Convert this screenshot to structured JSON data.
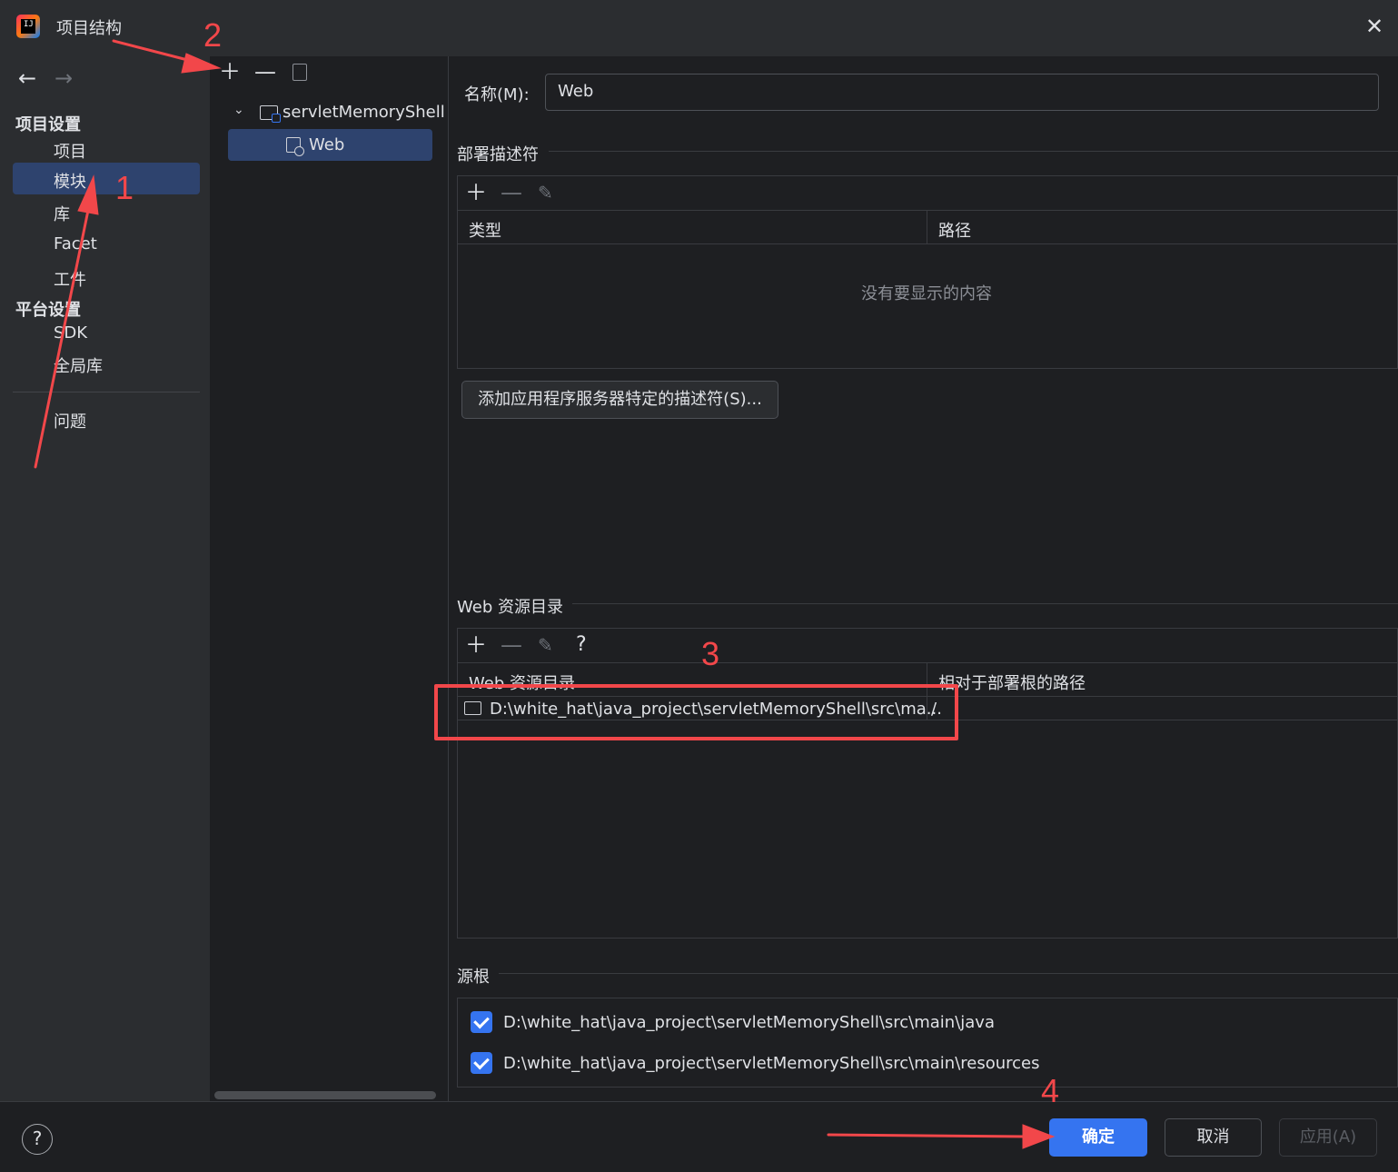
{
  "window": {
    "title": "项目结构",
    "app_logo_text": "IJ"
  },
  "sidebar": {
    "section_project": "项目设置",
    "items_project": [
      {
        "label": "项目"
      },
      {
        "label": "模块",
        "selected": true
      },
      {
        "label": "库"
      },
      {
        "label": "Facet"
      },
      {
        "label": "工件"
      }
    ],
    "section_platform": "平台设置",
    "items_platform": [
      {
        "label": "SDK"
      },
      {
        "label": "全局库"
      }
    ],
    "problems": "问题"
  },
  "module_tree": {
    "root": "servletMemoryShell",
    "child": "Web"
  },
  "facet": {
    "name_label": "名称(M):",
    "name_value": "Web",
    "deploy_section": "部署描述符",
    "deploy_columns": [
      "类型",
      "路径"
    ],
    "deploy_empty": "没有要显示的内容",
    "add_descriptor_button": "添加应用程序服务器特定的描述符(S)...",
    "web_res_section": "Web 资源目录",
    "web_res_columns": [
      "Web 资源目录",
      "相对于部署根的路径"
    ],
    "web_res_rows": [
      {
        "dir": "D:\\white_hat\\java_project\\servletMemoryShell\\src\\ma...",
        "path": "/"
      }
    ],
    "source_roots_section": "源根",
    "source_roots": [
      {
        "path": "D:\\white_hat\\java_project\\servletMemoryShell\\src\\main\\java",
        "checked": true
      },
      {
        "path": "D:\\white_hat\\java_project\\servletMemoryShell\\src\\main\\resources",
        "checked": true
      }
    ]
  },
  "footer": {
    "ok": "确定",
    "cancel": "取消",
    "apply": "应用(A)"
  },
  "annotations": {
    "n1": "1",
    "n2": "2",
    "n3": "3",
    "n4": "4",
    "color": "#f2474a"
  },
  "colors": {
    "accent": "#3574f0",
    "selection": "#2e436e",
    "panel": "#2b2d30",
    "background": "#1e1f22"
  }
}
